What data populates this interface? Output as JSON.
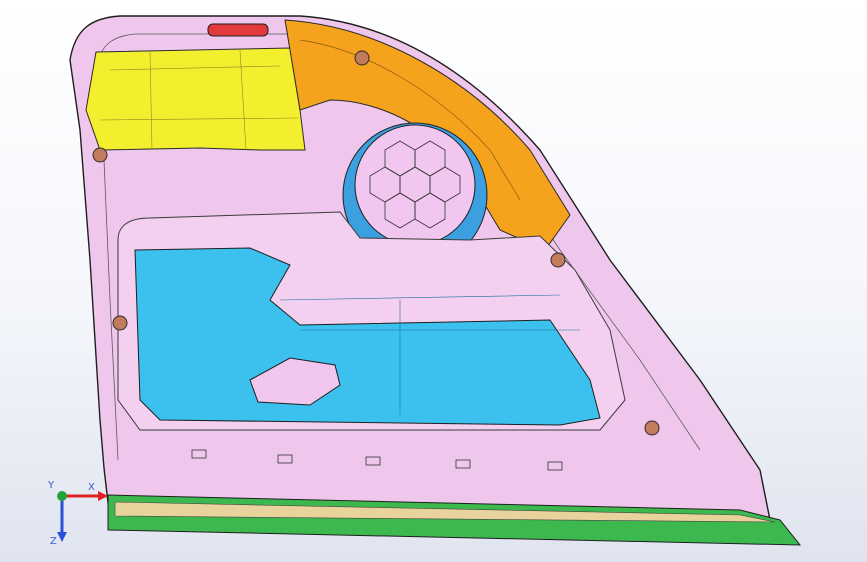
{
  "viewport": {
    "view_type": "3D CAD viewport",
    "colors": {
      "trim_pink": "#efc7ec",
      "pocket_blue": "#3cc0ee",
      "speaker_cover_orange": "#f5a21c",
      "top_panel_yellow": "#f4ef2e",
      "speaker_ring": "#3b9fe0",
      "strip_green": "#3cb84f",
      "edge_line": "#1f1f1f"
    },
    "icons": {
      "fastener": "round-clip-icon",
      "triad": "axis-triad-icon"
    }
  },
  "triad": {
    "x_label": "X",
    "y_label": "Y",
    "z_label": "Z",
    "x_color": "#e02020",
    "y_color": "#1fa53a",
    "z_color": "#2b4fd6"
  }
}
